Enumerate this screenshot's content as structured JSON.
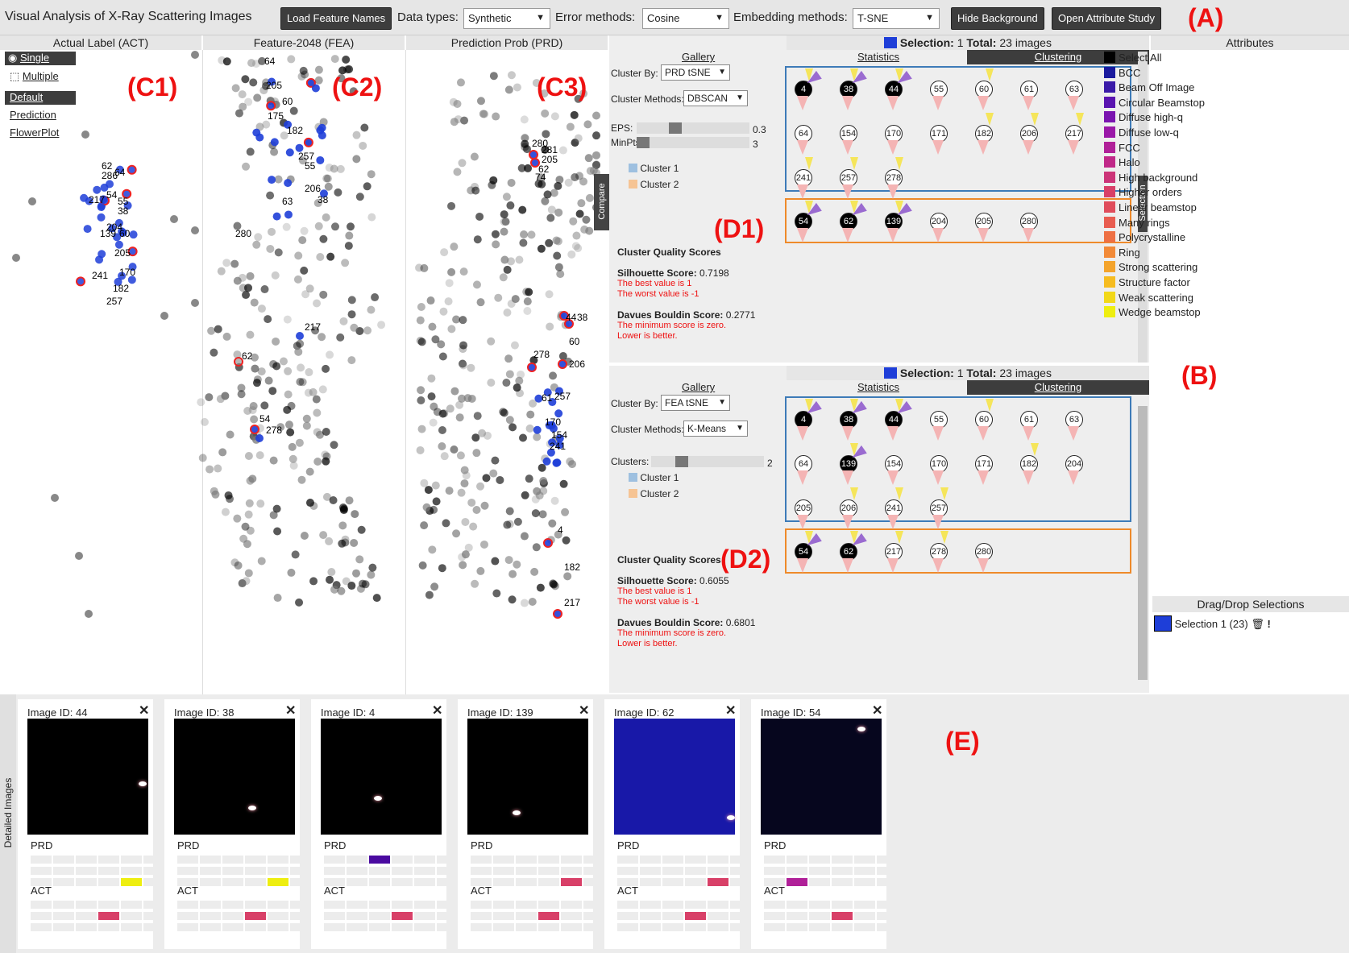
{
  "header": {
    "title": "Visual Analysis of X-Ray Scattering Images",
    "load_button": "Load Feature Names",
    "data_types_label": "Data types:",
    "data_types_value": "Synthetic",
    "error_methods_label": "Error methods:",
    "error_methods_value": "Cosine",
    "embedding_label": "Embedding methods:",
    "embedding_value": "T-SNE",
    "hide_bg_button": "Hide Background",
    "attr_study_button": "Open Attribute Study"
  },
  "annotations": {
    "A": "(A)",
    "B": "(B)",
    "C1": "(C1)",
    "C2": "(C2)",
    "C3": "(C3)",
    "D1": "(D1)",
    "D2": "(D2)",
    "E": "(E)"
  },
  "scatter_panels": {
    "act": "Actual Label (ACT)",
    "fea": "Feature-2048 (FEA)",
    "prd": "Prediction Prob (PRD)"
  },
  "act_controls": {
    "single": "Single",
    "multiple": "Multiple",
    "default": "Default",
    "prediction": "Prediction",
    "flowerplot": "FlowerPlot"
  },
  "compare_label": "Compare",
  "selection_side_label": "Selection",
  "cluster_panels": [
    {
      "selection_label": "Selection:",
      "selection_count": "1",
      "total_label": "Total:",
      "total_value": "23 images",
      "tabs": [
        "Gallery",
        "Statistics",
        "Clustering"
      ],
      "cluster_by_label": "Cluster By:",
      "cluster_by_value": "PRD tSNE",
      "methods_label": "Cluster Methods:",
      "methods_value": "DBSCAN",
      "sliders": [
        {
          "label": "EPS:",
          "value": "0.3"
        },
        {
          "label": "MinPts:",
          "value": "3"
        }
      ],
      "legend": [
        "Cluster 1",
        "Cluster 2"
      ],
      "quality_title": "Cluster Quality Scores",
      "silhouette_label": "Silhouette Score:",
      "silhouette_value": "0.7198",
      "silhouette_best": "The best value is 1",
      "silhouette_worst": "The worst value is -1",
      "davies_label": "Davues Bouldin Score:",
      "davies_value": "0.2771",
      "davies_note1": "The minimum score is zero.",
      "davies_note2": "Lower is better.",
      "cluster1": [
        "4",
        "38",
        "44",
        "55",
        "60",
        "61",
        "63",
        "64",
        "154",
        "170",
        "171",
        "182",
        "206",
        "217",
        "241",
        "257",
        "278"
      ],
      "cluster1_dark": [
        "4",
        "38",
        "44"
      ],
      "cluster2": [
        "54",
        "62",
        "139",
        "204",
        "205",
        "280"
      ],
      "cluster2_dark": [
        "54",
        "62",
        "139"
      ]
    },
    {
      "selection_label": "Selection:",
      "selection_count": "1",
      "total_label": "Total:",
      "total_value": "23 images",
      "tabs": [
        "Gallery",
        "Statistics",
        "Clustering"
      ],
      "cluster_by_label": "Cluster By:",
      "cluster_by_value": "FEA tSNE",
      "methods_label": "Cluster Methods:",
      "methods_value": "K-Means",
      "sliders": [
        {
          "label": "Clusters:",
          "value": "2"
        }
      ],
      "legend": [
        "Cluster 1",
        "Cluster 2"
      ],
      "quality_title": "Cluster Quality Scores",
      "silhouette_label": "Silhouette Score:",
      "silhouette_value": "0.6055",
      "silhouette_best": "The best value is 1",
      "silhouette_worst": "The worst value is -1",
      "davies_label": "Davues Bouldin Score:",
      "davies_value": "0.6801",
      "davies_note1": "The minimum score is zero.",
      "davies_note2": "Lower is better.",
      "cluster1": [
        "4",
        "38",
        "44",
        "55",
        "60",
        "61",
        "63",
        "64",
        "139",
        "154",
        "170",
        "171",
        "182",
        "204",
        "205",
        "206",
        "241",
        "257"
      ],
      "cluster1_dark": [
        "4",
        "38",
        "44",
        "139"
      ],
      "cluster2": [
        "54",
        "62",
        "217",
        "278",
        "280"
      ],
      "cluster2_dark": [
        "54",
        "62"
      ]
    }
  ],
  "attributes": {
    "title": "Attributes",
    "items": [
      {
        "label": "Select All",
        "color": "#000000"
      },
      {
        "label": "BCC",
        "color": "#1a1a9e"
      },
      {
        "label": "Beam Off Image",
        "color": "#3a1aa8"
      },
      {
        "label": "Circular Beamstop",
        "color": "#5a14b0"
      },
      {
        "label": "Diffuse high-q",
        "color": "#7a14b0"
      },
      {
        "label": "Diffuse low-q",
        "color": "#9a18a8"
      },
      {
        "label": "FCC",
        "color": "#b02098"
      },
      {
        "label": "Halo",
        "color": "#c02888"
      },
      {
        "label": "High background",
        "color": "#cc3478"
      },
      {
        "label": "Higher orders",
        "color": "#d84068"
      },
      {
        "label": "Linear beamstop",
        "color": "#e04c5c"
      },
      {
        "label": "Many rings",
        "color": "#e85c50"
      },
      {
        "label": "Polycrystalline",
        "color": "#ee7044"
      },
      {
        "label": "Ring",
        "color": "#f28a38"
      },
      {
        "label": "Strong scattering",
        "color": "#f4a42c"
      },
      {
        "label": "Structure factor",
        "color": "#f6bc20"
      },
      {
        "label": "Weak scattering",
        "color": "#f2d818"
      },
      {
        "label": "Wedge beamstop",
        "color": "#eeee10"
      }
    ]
  },
  "dragdrop": {
    "title": "Drag/Drop Selections",
    "item": "Selection 1 (23)"
  },
  "detailed": {
    "side_label": "Detailed Images",
    "prd_label": "PRD",
    "act_label": "ACT",
    "cards": [
      {
        "id": "Image ID: 44",
        "bg": "#000000"
      },
      {
        "id": "Image ID: 38",
        "bg": "#000000"
      },
      {
        "id": "Image ID: 4",
        "bg": "#000000"
      },
      {
        "id": "Image ID: 139",
        "bg": "#000000"
      },
      {
        "id": "Image ID: 62",
        "bg": "#1818a8"
      },
      {
        "id": "Image ID: 54",
        "bg": "#06061e"
      }
    ]
  }
}
